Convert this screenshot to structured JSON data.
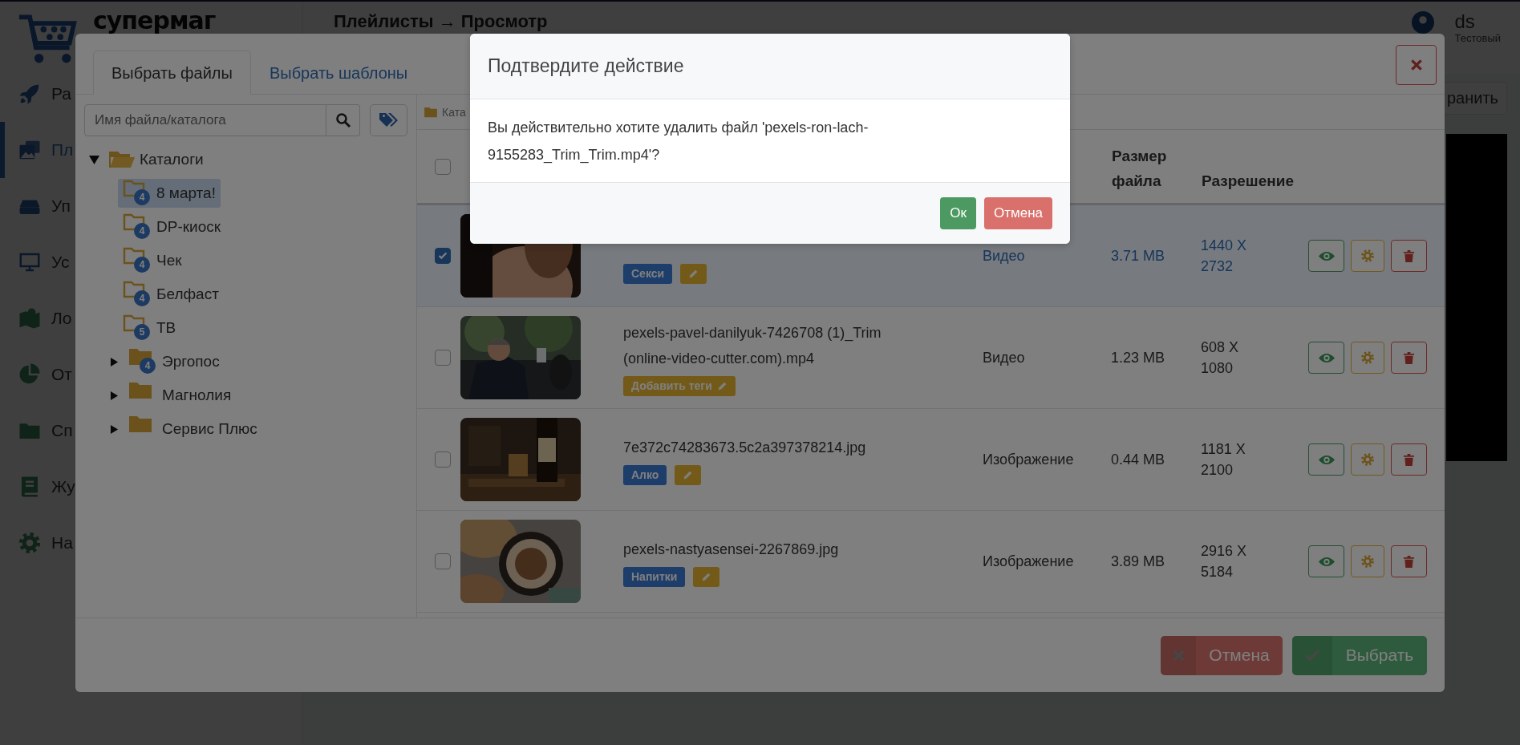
{
  "app": {
    "logo": "супермаг",
    "page_title": "Плейлисты → Просмотр",
    "user": {
      "name": "ds",
      "role": "Тестовый"
    },
    "save_button": "ранить"
  },
  "sidebar": {
    "items": [
      {
        "label": "Ра",
        "selected": false
      },
      {
        "label": "Пл",
        "selected": true
      },
      {
        "label": "Уп",
        "selected": false
      },
      {
        "label": "Ус",
        "selected": false
      },
      {
        "label": "Ло",
        "selected": false
      },
      {
        "label": "От",
        "selected": false
      },
      {
        "label": "Сп",
        "selected": false
      },
      {
        "label": "Жу",
        "selected": false
      },
      {
        "label": "На",
        "selected": false
      }
    ]
  },
  "file_dialog": {
    "tabs": [
      {
        "label": "Выбрать файлы",
        "selected": true
      },
      {
        "label": "Выбрать шаблоны",
        "selected": false
      }
    ],
    "search": {
      "placeholder": "Имя файла/каталога"
    },
    "tree": {
      "label": "Каталоги",
      "expanded": true,
      "children": [
        {
          "label": "8 марта!",
          "badge": "4",
          "kind": "leaf",
          "selected": true
        },
        {
          "label": "DP-киоск",
          "badge": "4",
          "kind": "leaf",
          "selected": false
        },
        {
          "label": "Чек",
          "badge": "4",
          "kind": "leaf",
          "selected": false
        },
        {
          "label": "Белфаст",
          "badge": "4",
          "kind": "leaf",
          "selected": false
        },
        {
          "label": "ТВ",
          "badge": "5",
          "kind": "leaf",
          "selected": false
        },
        {
          "label": "Эргопос",
          "badge": "4",
          "kind": "branch",
          "expanded": false,
          "selected": false
        },
        {
          "label": "Магнолия",
          "kind": "branch",
          "expanded": false,
          "selected": false
        },
        {
          "label": "Сервис Плюс",
          "kind": "branch",
          "expanded": false,
          "selected": false
        }
      ]
    },
    "breadcrumb": "Ката",
    "table": {
      "header_checked": false,
      "columns": [
        "Размер файла",
        "Разрешение"
      ],
      "rows": [
        {
          "checked": true,
          "selected": true,
          "tags": [
            "Секси"
          ],
          "edit": {
            "kind": "icon"
          },
          "type": "Видео",
          "size": "3.71 MB",
          "resolution": "1440 X 2732"
        },
        {
          "checked": false,
          "selected": false,
          "name": "pexels-pavel-danilyuk-7426708 (1)_Trim (online-video-cutter.com).mp4",
          "edit": {
            "kind": "labeled",
            "label": "Добавить теги"
          },
          "type": "Видео",
          "size": "1.23 MB",
          "resolution": "608 X 1080"
        },
        {
          "checked": false,
          "selected": false,
          "name": "7e372c74283673.5c2a397378214.jpg",
          "tags": [
            "Алко"
          ],
          "edit": {
            "kind": "icon"
          },
          "type": "Изображение",
          "size": "0.44 MB",
          "resolution": "1181 X 2100"
        },
        {
          "checked": false,
          "selected": false,
          "name": "pexels-nastyasensei-2267869.jpg",
          "tags": [
            "Напитки"
          ],
          "edit": {
            "kind": "icon"
          },
          "type": "Изображение",
          "size": "3.89 MB",
          "resolution": "2916 X 5184"
        }
      ]
    },
    "buttons": [
      {
        "label": "Отмена",
        "kind": "cancel"
      },
      {
        "label": "Выбрать",
        "kind": "confirm"
      }
    ]
  },
  "confirm_dialog": {
    "title": "Подтвердите действие",
    "message": "Вы действительно хотите удалить файл 'pexels-ron-lach-9155283_Trim_Trim.mp4'?",
    "buttons": [
      {
        "label": "Ок",
        "kind": "confirm"
      },
      {
        "label": "Отмена",
        "kind": "cancel"
      }
    ]
  }
}
